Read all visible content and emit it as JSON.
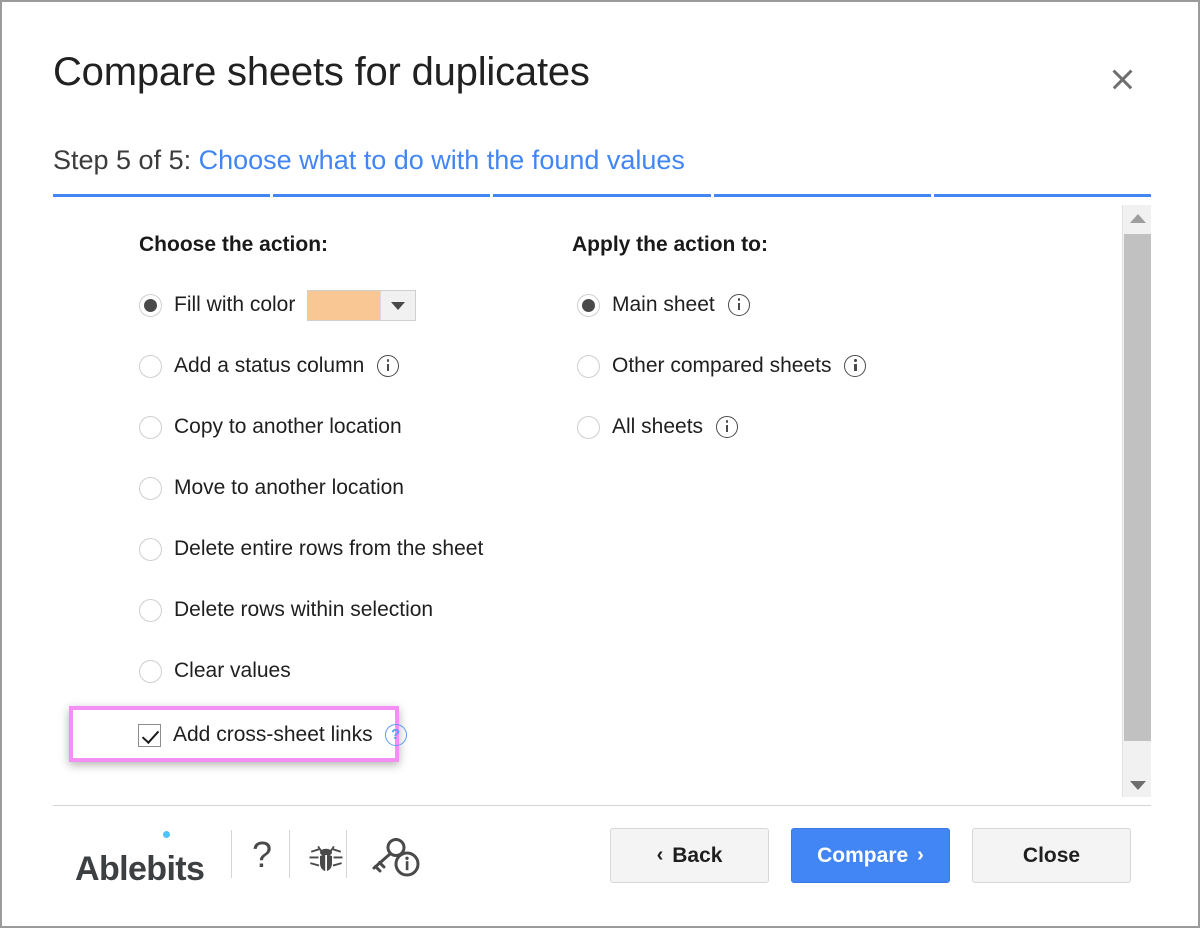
{
  "dialog": {
    "title": "Compare sheets for duplicates",
    "close_icon": "close-icon",
    "step_prefix": "Step 5 of 5: ",
    "step_link": "Choose what to do with the found values",
    "progress_steps": 5,
    "current_step": 5
  },
  "content": {
    "left": {
      "heading": "Choose the action:",
      "options": [
        {
          "label": "Fill with color",
          "selected": true,
          "has_info": false,
          "has_color": true
        },
        {
          "label": "Add a status column",
          "selected": false,
          "has_info": true,
          "has_color": false
        },
        {
          "label": "Copy to another location",
          "selected": false,
          "has_info": false,
          "has_color": false
        },
        {
          "label": "Move to another location",
          "selected": false,
          "has_info": false,
          "has_color": false
        },
        {
          "label": "Delete entire rows from the sheet",
          "selected": false,
          "has_info": false,
          "has_color": false
        },
        {
          "label": "Delete rows within selection",
          "selected": false,
          "has_info": false,
          "has_color": false
        },
        {
          "label": "Clear values",
          "selected": false,
          "has_info": false,
          "has_color": false
        }
      ],
      "fill_color": "#f8c794",
      "checkbox": {
        "label": "Add cross-sheet links",
        "checked": true,
        "help_icon_label": "?",
        "highlight_color": "#f48ff4"
      }
    },
    "right": {
      "heading": "Apply the action to:",
      "options": [
        {
          "label": "Main sheet",
          "selected": true,
          "has_info": true
        },
        {
          "label": "Other compared sheets",
          "selected": false,
          "has_info": true
        },
        {
          "label": "All sheets",
          "selected": false,
          "has_info": true
        }
      ]
    }
  },
  "footer": {
    "brand": "Ablebits",
    "help_icon": "?",
    "bug_icon": "bug-icon",
    "key_info_icon": "key-info-icon",
    "buttons": {
      "back": "Back",
      "back_chevron": "‹",
      "compare": "Compare",
      "compare_chevron": "›",
      "close": "Close"
    }
  },
  "colors": {
    "accent_blue": "#4285f4",
    "highlight_pink": "#f48ff4",
    "fill_swatch": "#f8c794",
    "help_blue": "#5b9bf5"
  }
}
